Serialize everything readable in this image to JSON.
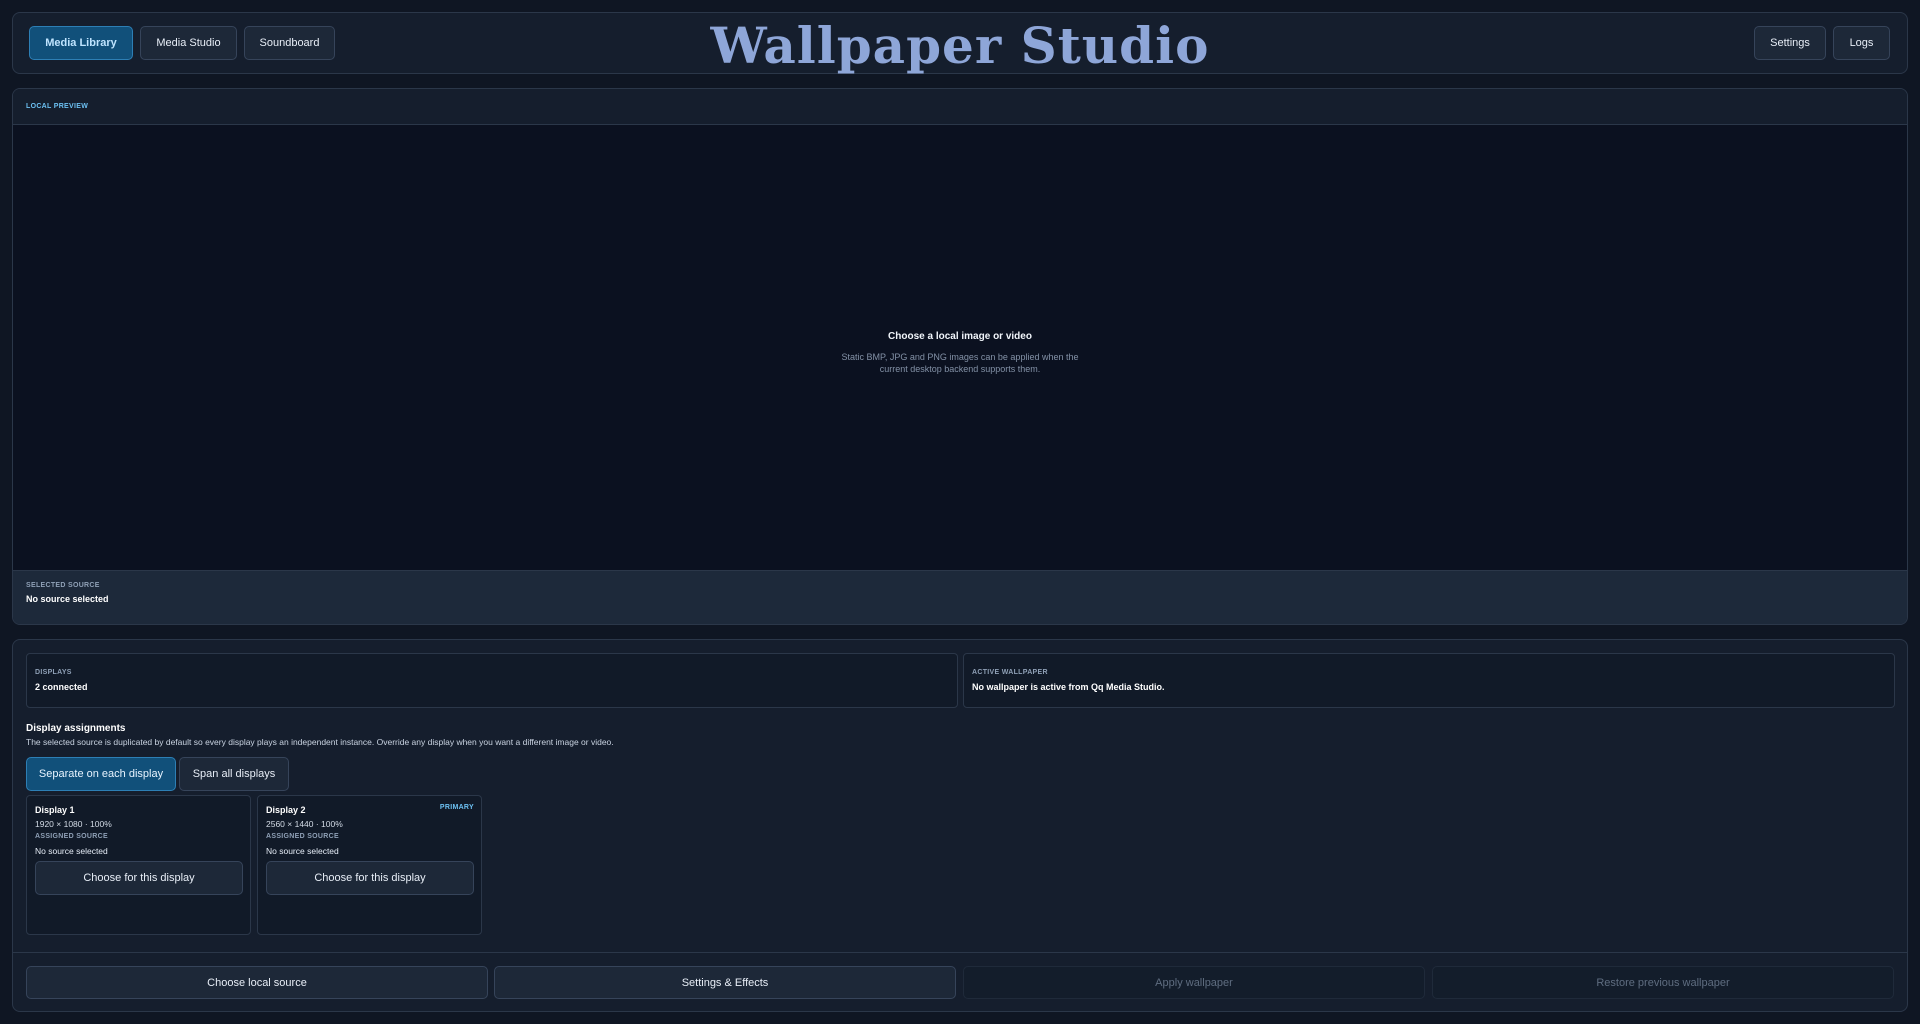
{
  "header": {
    "title": "Wallpaper Studio",
    "nav": {
      "media_library": "Media Library",
      "media_studio": "Media Studio",
      "soundboard": "Soundboard"
    },
    "settings": "Settings",
    "logs": "Logs"
  },
  "preview": {
    "label": "LOCAL PREVIEW",
    "empty_title": "Choose a local image or video",
    "empty_subtitle": "Static BMP, JPG and PNG images can be applied when the current desktop backend supports them.",
    "selected_label": "SELECTED SOURCE",
    "selected_value": "No source selected"
  },
  "status": {
    "displays_label": "DISPLAYS",
    "displays_value": "2 connected",
    "active_label": "ACTIVE WALLPAPER",
    "active_value": "No wallpaper is active from Qq Media Studio."
  },
  "assignments": {
    "title": "Display assignments",
    "description": "The selected source is duplicated by default so every display plays an independent instance. Override any display when you want a different image or video.",
    "mode_separate": "Separate on each display",
    "mode_span": "Span all displays",
    "displays": [
      {
        "name": "Display 1",
        "resolution": "1920 × 1080 · 100%",
        "assigned_label": "ASSIGNED SOURCE",
        "source": "No source selected",
        "button": "Choose for this display",
        "badge": ""
      },
      {
        "name": "Display 2",
        "resolution": "2560 × 1440 · 100%",
        "assigned_label": "ASSIGNED SOURCE",
        "source": "No source selected",
        "button": "Choose for this display",
        "badge": "PRIMARY"
      }
    ]
  },
  "actions": {
    "choose_local": "Choose local source",
    "settings_effects": "Settings & Effects",
    "apply": "Apply wallpaper",
    "restore": "Restore previous wallpaper"
  },
  "colors": {
    "background": "#0f1623",
    "accent": "#6cc0f2",
    "active_button": "#11507a",
    "title": "#8ea6d8"
  }
}
